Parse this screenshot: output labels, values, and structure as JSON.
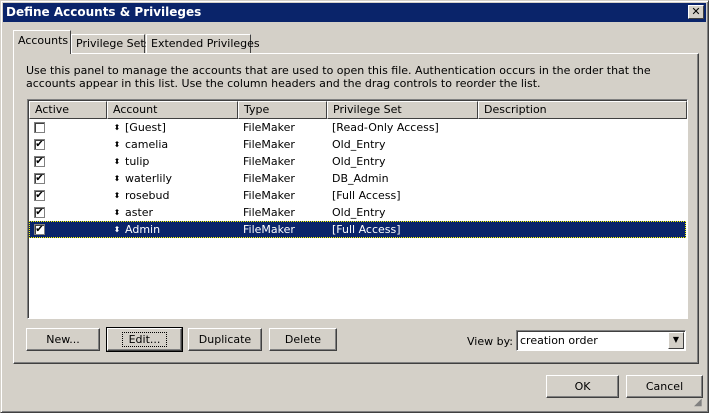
{
  "window": {
    "title": "Define Accounts & Privileges"
  },
  "tabs": [
    {
      "label": "Accounts"
    },
    {
      "label": "Privilege Sets"
    },
    {
      "label": "Extended Privileges"
    }
  ],
  "description": "Use this panel to manage the accounts that are used to open this file. Authentication occurs in the order that the accounts appear in this list. Use the column headers and the drag controls to reorder the list.",
  "table": {
    "columns": [
      "Active",
      "Account",
      "Type",
      "Privilege Set",
      "Description"
    ],
    "rows": [
      {
        "active": false,
        "account": "[Guest]",
        "type": "FileMaker",
        "privilege_set": "[Read-Only Access]",
        "description": ""
      },
      {
        "active": true,
        "account": "camelia",
        "type": "FileMaker",
        "privilege_set": "Old_Entry",
        "description": ""
      },
      {
        "active": true,
        "account": "tulip",
        "type": "FileMaker",
        "privilege_set": "Old_Entry",
        "description": ""
      },
      {
        "active": true,
        "account": "waterlily",
        "type": "FileMaker",
        "privilege_set": "DB_Admin",
        "description": ""
      },
      {
        "active": true,
        "account": "rosebud",
        "type": "FileMaker",
        "privilege_set": "[Full Access]",
        "description": ""
      },
      {
        "active": true,
        "account": "aster",
        "type": "FileMaker",
        "privilege_set": "Old_Entry",
        "description": ""
      },
      {
        "active": true,
        "account": "Admin",
        "type": "FileMaker",
        "privilege_set": "[Full Access]",
        "description": "",
        "selected": true
      }
    ],
    "check_glyph": "✔",
    "drag_glyph": "⬍"
  },
  "buttons": {
    "new": "New...",
    "edit": "Edit...",
    "duplicate": "Duplicate",
    "delete": "Delete",
    "ok": "OK",
    "cancel": "Cancel"
  },
  "view_by": {
    "label": "View by:",
    "value": "creation order"
  },
  "colors": {
    "selection": "#0a246a",
    "titlebar": "#0a246a",
    "face": "#d4d0c8"
  }
}
